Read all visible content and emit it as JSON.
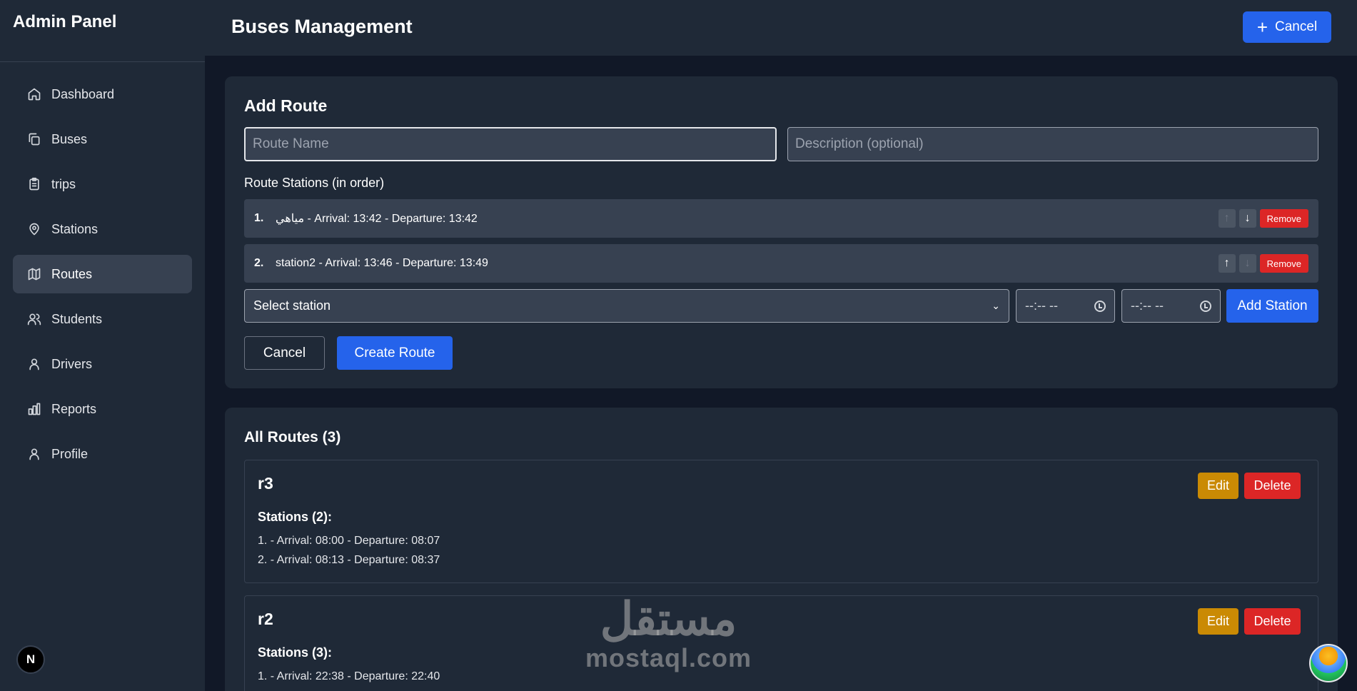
{
  "sidebar": {
    "brand": "Admin Panel",
    "items": [
      {
        "label": "Dashboard",
        "icon": "home-icon"
      },
      {
        "label": "Buses",
        "icon": "copy-icon"
      },
      {
        "label": "trips",
        "icon": "clipboard-icon"
      },
      {
        "label": "Stations",
        "icon": "map-pin-icon"
      },
      {
        "label": "Routes",
        "icon": "map-icon",
        "active": true
      },
      {
        "label": "Students",
        "icon": "users-icon"
      },
      {
        "label": "Drivers",
        "icon": "user-icon"
      },
      {
        "label": "Reports",
        "icon": "bar-chart-icon"
      },
      {
        "label": "Profile",
        "icon": "user-icon"
      }
    ],
    "badge": "N"
  },
  "header": {
    "title": "Buses Management",
    "action_label": "Cancel"
  },
  "add_route": {
    "title": "Add Route",
    "route_name_placeholder": "Route Name",
    "description_placeholder": "Description (optional)",
    "stations_label": "Route Stations (in order)",
    "stations": [
      {
        "num": "1.",
        "text": "مياهي - Arrival: 13:42 - Departure: 13:42"
      },
      {
        "num": "2.",
        "text": "station2 - Arrival: 13:46 - Departure: 13:49"
      }
    ],
    "up_label": "↑",
    "down_label": "↓",
    "remove_label": "Remove",
    "select_station": "Select station",
    "time_placeholder": "--:-- --",
    "add_station_label": "Add Station",
    "cancel_label": "Cancel",
    "create_label": "Create Route"
  },
  "all_routes": {
    "title": "All Routes (3)",
    "edit_label": "Edit",
    "delete_label": "Delete",
    "routes": [
      {
        "name": "r3",
        "stations_heading": "Stations (2):",
        "lines": [
          "1. - Arrival: 08:00 - Departure: 08:07",
          "2. - Arrival: 08:13 - Departure: 08:37"
        ]
      },
      {
        "name": "r2",
        "stations_heading": "Stations (3):",
        "lines": [
          "1. - Arrival: 22:38 - Departure: 22:40"
        ]
      }
    ]
  },
  "watermark": {
    "arabic": "مستقل",
    "latin": "mostaql.com"
  },
  "colors": {
    "bg": "#111827",
    "panel": "#1f2937",
    "accent": "#2563eb",
    "danger": "#dc2626",
    "warning": "#ca8a04"
  }
}
